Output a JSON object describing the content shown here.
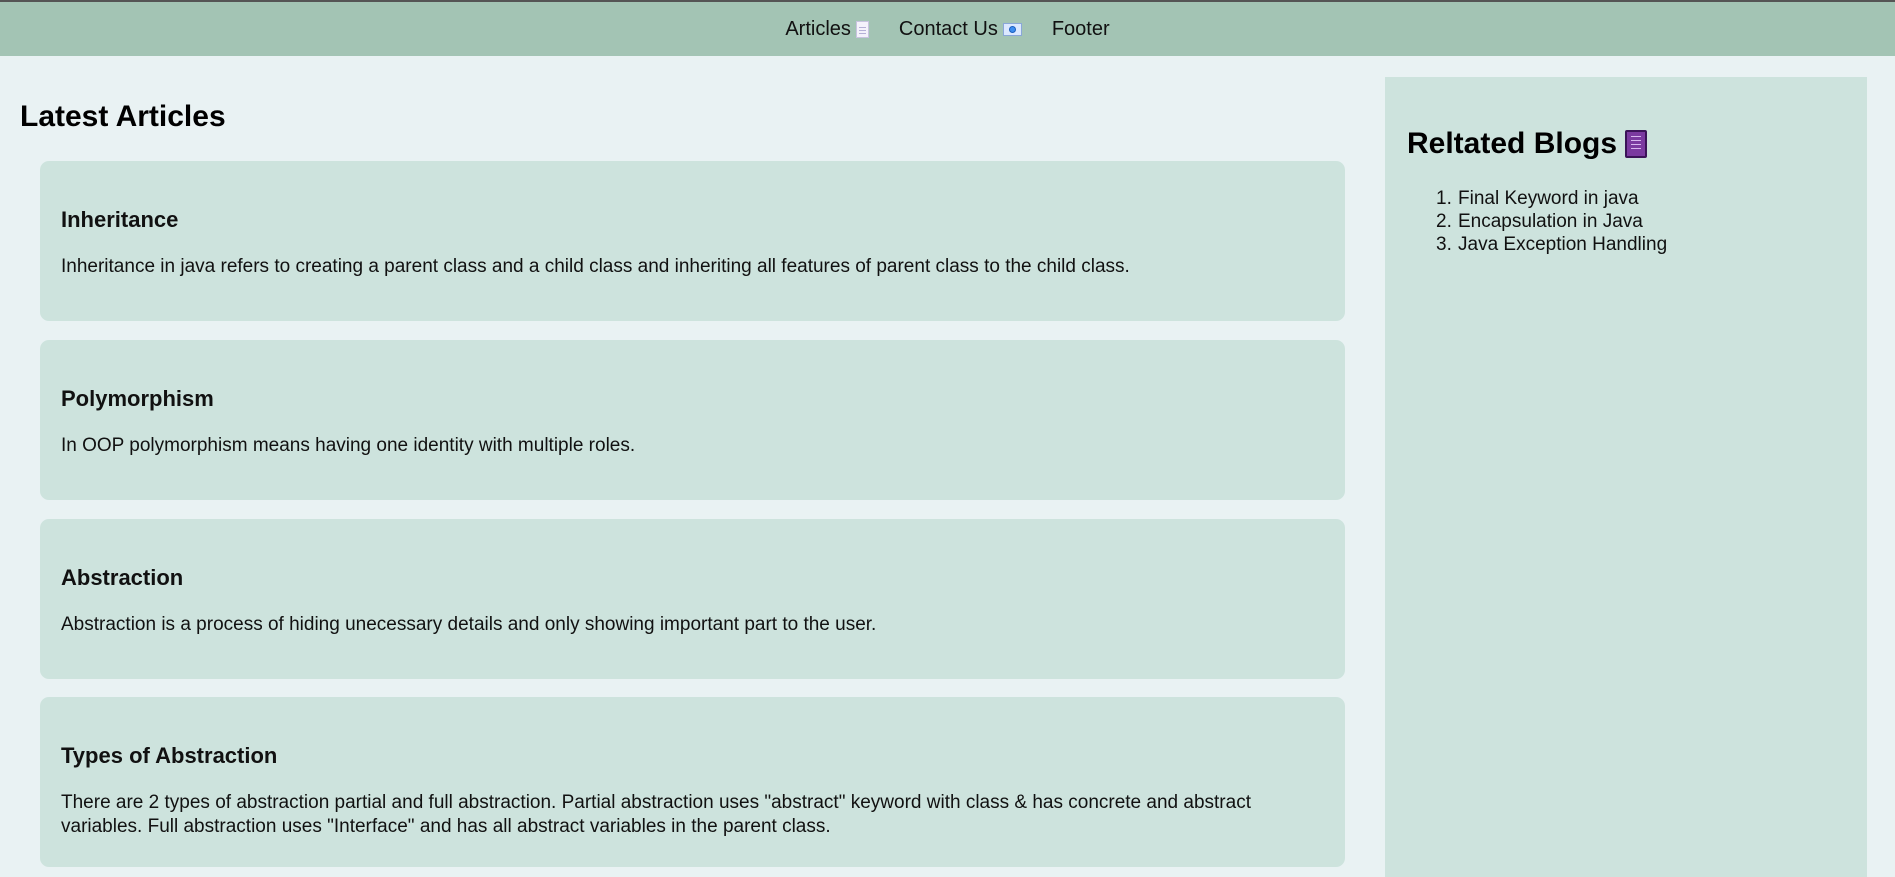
{
  "nav": {
    "items": [
      {
        "label": "Articles",
        "icon": "document-icon"
      },
      {
        "label": "Contact Us",
        "icon": "envelope-icon"
      },
      {
        "label": "Footer",
        "icon": ""
      }
    ]
  },
  "main": {
    "title": "Latest Articles",
    "articles": [
      {
        "title": "Inheritance",
        "body": "Inheritance in java refers to creating a parent class and a child class and inheriting all features of parent class to the child class."
      },
      {
        "title": "Polymorphism",
        "body": "In OOP polymorphism means having one identity with multiple roles."
      },
      {
        "title": "Abstraction",
        "body": "Abstraction is a process of hiding unecessary details and only showing important part to the user."
      },
      {
        "title": "Types of Abstraction",
        "body": "There are 2 types of abstraction partial and full abstraction. Partial abstraction uses \"abstract\" keyword with class & has concrete and abstract variables. Full abstraction uses \"Interface\" and has all abstract variables in the parent class."
      }
    ]
  },
  "sidebar": {
    "title": "Reltated Blogs",
    "icon": "book-icon",
    "items": [
      {
        "number": "1.",
        "label": "Final Keyword in java"
      },
      {
        "number": "2.",
        "label": "Encapsulation in Java"
      },
      {
        "number": "3.",
        "label": "Java Exception Handling"
      }
    ]
  },
  "colors": {
    "page_background": "#e9f2f3",
    "nav_background": "#a3c4b4",
    "card_background": "#cde3dd"
  }
}
